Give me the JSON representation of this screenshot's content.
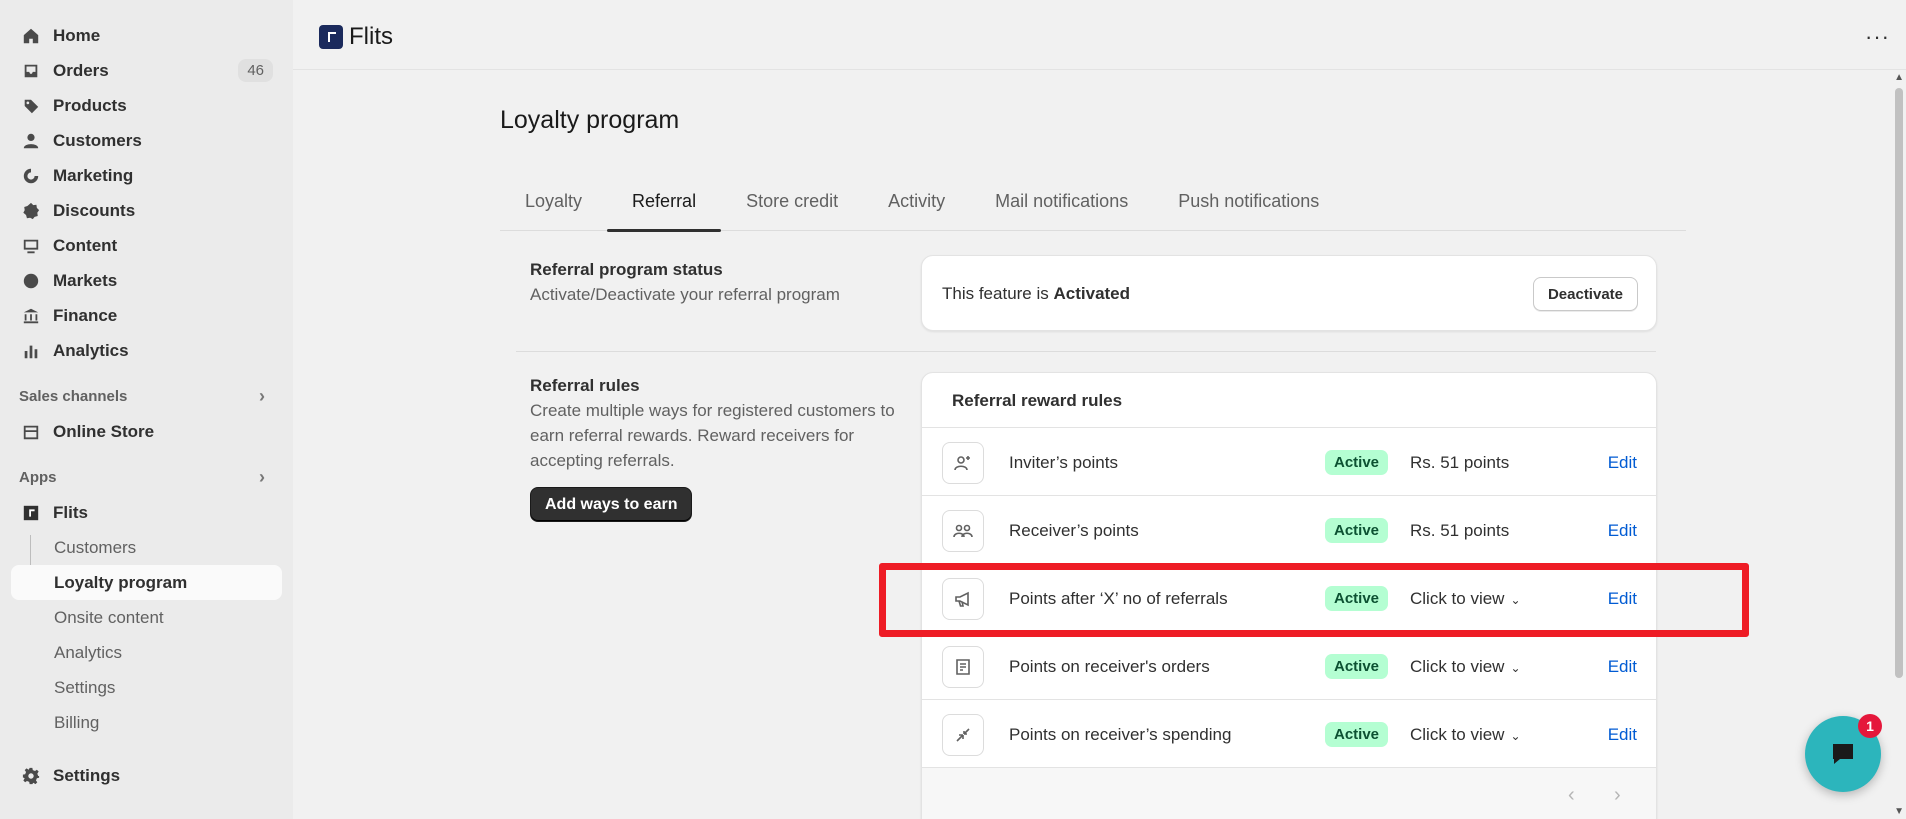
{
  "sidebar": {
    "nav": [
      {
        "label": "Home",
        "icon": "home-icon"
      },
      {
        "label": "Orders",
        "icon": "inbox-icon",
        "count": "46"
      },
      {
        "label": "Products",
        "icon": "tag-icon"
      },
      {
        "label": "Customers",
        "icon": "person-icon"
      },
      {
        "label": "Marketing",
        "icon": "target-icon"
      },
      {
        "label": "Discounts",
        "icon": "discount-icon"
      },
      {
        "label": "Content",
        "icon": "content-icon"
      },
      {
        "label": "Markets",
        "icon": "globe-icon"
      },
      {
        "label": "Finance",
        "icon": "bank-icon"
      },
      {
        "label": "Analytics",
        "icon": "bar-chart-icon"
      }
    ],
    "sales_channels_label": "Sales channels",
    "online_store_label": "Online Store",
    "apps_label": "Apps",
    "flits_label": "Flits",
    "flits_sub": [
      "Customers",
      "Loyalty program",
      "Onsite content",
      "Analytics",
      "Settings",
      "Billing"
    ],
    "settings_label": "Settings"
  },
  "topbar": {
    "app_name": "Flits",
    "more_label": "···"
  },
  "page": {
    "title": "Loyalty program",
    "tabs": [
      "Loyalty",
      "Referral",
      "Store credit",
      "Activity",
      "Mail notifications",
      "Push notifications"
    ],
    "active_tab": "Referral"
  },
  "status_section": {
    "title": "Referral program status",
    "description": "Activate/Deactivate your referral program",
    "feature_prefix": "This feature is ",
    "feature_state": "Activated",
    "deactivate_label": "Deactivate"
  },
  "rules_section": {
    "title": "Referral rules",
    "description": "Create multiple ways for registered customers to earn referral rewards. Reward receivers for accepting referrals.",
    "add_label": "Add ways to earn",
    "card_title": "Referral reward rules",
    "rows": [
      {
        "name": "Inviter’s points",
        "status": "Active",
        "value": "Rs. 51 points",
        "has_caret": false,
        "edit": "Edit",
        "icon": "person-add-icon"
      },
      {
        "name": "Receiver’s points",
        "status": "Active",
        "value": "Rs. 51 points",
        "has_caret": false,
        "edit": "Edit",
        "icon": "people-icon"
      },
      {
        "name": "Points after ‘X’ no of referrals",
        "status": "Active",
        "value": "Click to view",
        "has_caret": true,
        "edit": "Edit",
        "icon": "megaphone-icon"
      },
      {
        "name": "Points on receiver's orders",
        "status": "Active",
        "value": "Click to view",
        "has_caret": true,
        "edit": "Edit",
        "icon": "order-icon"
      },
      {
        "name": "Points on receiver’s spending",
        "status": "Active",
        "value": "Click to view",
        "has_caret": true,
        "edit": "Edit",
        "icon": "spending-icon"
      }
    ]
  },
  "chat": {
    "badge_count": "1"
  },
  "colors": {
    "accent": "#005bd3",
    "active_badge": "#b4fed2",
    "highlight": "#ee1c25",
    "chat": "#2cb5bc"
  }
}
